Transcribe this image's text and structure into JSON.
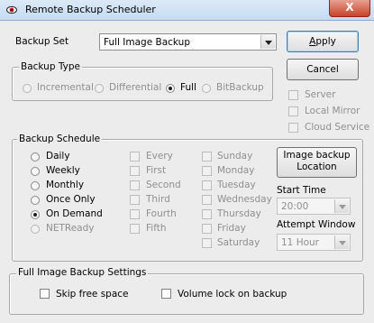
{
  "window": {
    "title": "Remote Backup Scheduler",
    "close_label": "X"
  },
  "backup_set": {
    "label": "Backup Set",
    "value": "Full Image Backup"
  },
  "buttons": {
    "apply_pre": "",
    "apply_mnemonic": "A",
    "apply_post": "pply",
    "cancel": "Cancel",
    "image_backup_location_line1": "Image backup",
    "image_backup_location_line2": "Location"
  },
  "backup_type": {
    "legend": "Backup Type",
    "options": [
      {
        "label": "Incremental",
        "selected": false,
        "enabled": false
      },
      {
        "label": "Differential",
        "selected": false,
        "enabled": false
      },
      {
        "label": "Full",
        "selected": true,
        "enabled": true
      },
      {
        "label": "BitBackup",
        "selected": false,
        "enabled": false
      }
    ]
  },
  "destinations": [
    {
      "label": "Server",
      "checked": false,
      "enabled": false
    },
    {
      "label": "Local Mirror",
      "checked": false,
      "enabled": false
    },
    {
      "label": "Cloud Service",
      "checked": false,
      "enabled": false
    }
  ],
  "backup_schedule": {
    "legend": "Backup Schedule",
    "frequency": [
      {
        "label": "Daily",
        "selected": false,
        "enabled": true
      },
      {
        "label": "Weekly",
        "selected": false,
        "enabled": true
      },
      {
        "label": "Monthly",
        "selected": false,
        "enabled": true
      },
      {
        "label": "Once Only",
        "selected": false,
        "enabled": true
      },
      {
        "label": "On Demand",
        "selected": true,
        "enabled": true
      },
      {
        "label": "NETReady",
        "selected": false,
        "enabled": false
      }
    ],
    "occurrence": [
      "Every",
      "First",
      "Second",
      "Third",
      "Fourth",
      "Fifth"
    ],
    "days": [
      "Sunday",
      "Monday",
      "Tuesday",
      "Wednesday",
      "Thursday",
      "Friday",
      "Saturday"
    ],
    "start_time_label": "Start Time",
    "start_time_value": "20:00",
    "attempt_window_label": "Attempt Window",
    "attempt_window_value": "11 Hour"
  },
  "image_settings": {
    "legend": "Full Image Backup Settings",
    "skip_free_space": "Skip free space",
    "volume_lock": "Volume lock on backup"
  }
}
